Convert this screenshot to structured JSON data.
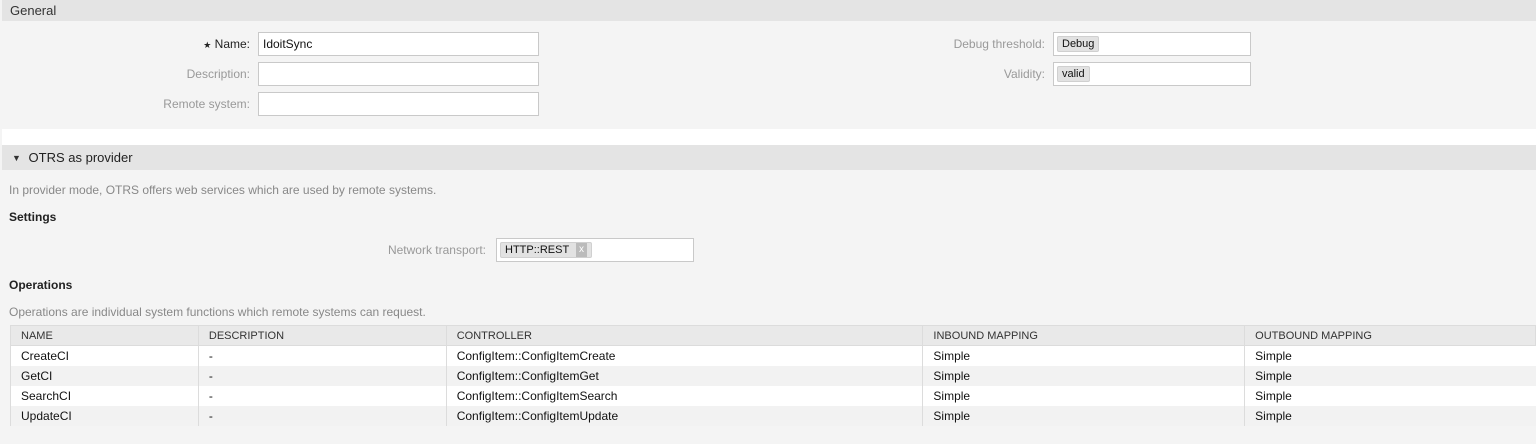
{
  "general": {
    "title": "General",
    "name_label": "Name:",
    "name_value": "IdoitSync",
    "required_marker": "★",
    "description_label": "Description:",
    "description_value": "",
    "remote_system_label": "Remote system:",
    "remote_system_value": "",
    "debug_label": "Debug threshold:",
    "debug_value": "Debug",
    "validity_label": "Validity:",
    "validity_value": "valid"
  },
  "provider": {
    "title": "OTRS as provider",
    "intro": "In provider mode, OTRS offers web services which are used by remote systems.",
    "settings_heading": "Settings",
    "network_label": "Network transport:",
    "network_value": "HTTP::REST",
    "remove_glyph": "x",
    "operations_heading": "Operations",
    "operations_intro": "Operations are individual system functions which remote systems can request.",
    "columns": [
      "NAME",
      "DESCRIPTION",
      "CONTROLLER",
      "INBOUND MAPPING",
      "OUTBOUND MAPPING"
    ],
    "rows": [
      [
        "CreateCI",
        "-",
        "ConfigItem::ConfigItemCreate",
        "Simple",
        "Simple"
      ],
      [
        "GetCI",
        "-",
        "ConfigItem::ConfigItemGet",
        "Simple",
        "Simple"
      ],
      [
        "SearchCI",
        "-",
        "ConfigItem::ConfigItemSearch",
        "Simple",
        "Simple"
      ],
      [
        "UpdateCI",
        "-",
        "ConfigItem::ConfigItemUpdate",
        "Simple",
        "Simple"
      ]
    ]
  }
}
